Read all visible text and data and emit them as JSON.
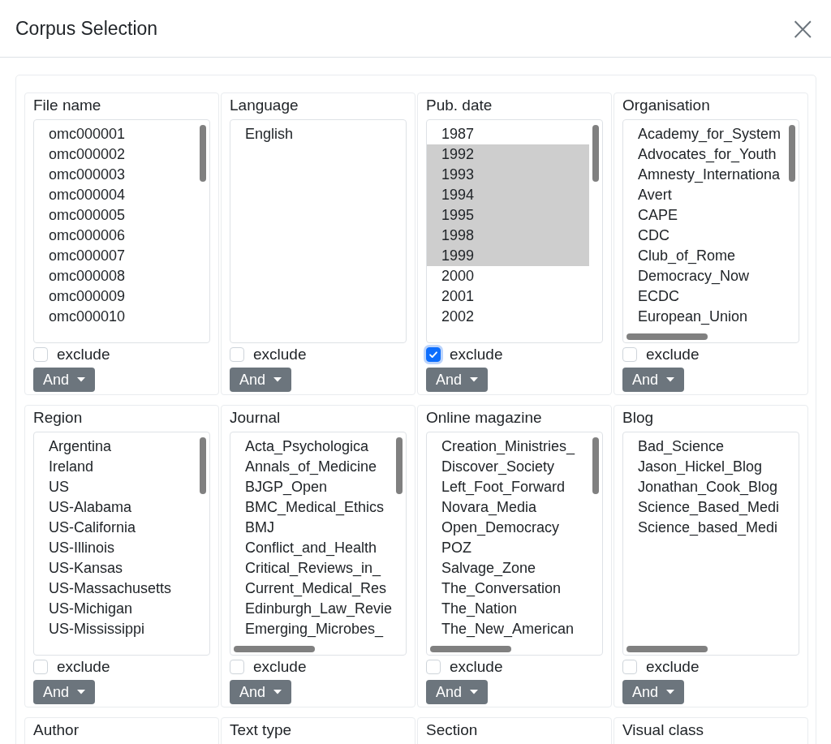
{
  "dialog": {
    "title": "Corpus Selection",
    "close": "×"
  },
  "filters": [
    {
      "label": "File name",
      "scrollbar_vertical": true,
      "scrollbar_horizontal": false,
      "exclude": false,
      "exclude_label": "exclude",
      "operator": "And",
      "options": [
        {
          "text": "omc000001",
          "selected": false
        },
        {
          "text": "omc000002",
          "selected": false
        },
        {
          "text": "omc000003",
          "selected": false
        },
        {
          "text": "omc000004",
          "selected": false
        },
        {
          "text": "omc000005",
          "selected": false
        },
        {
          "text": "omc000006",
          "selected": false
        },
        {
          "text": "omc000007",
          "selected": false
        },
        {
          "text": "omc000008",
          "selected": false
        },
        {
          "text": "omc000009",
          "selected": false
        },
        {
          "text": "omc000010",
          "selected": false
        }
      ]
    },
    {
      "label": "Language",
      "scrollbar_vertical": false,
      "scrollbar_horizontal": false,
      "exclude": false,
      "exclude_label": "exclude",
      "operator": "And",
      "options": [
        {
          "text": "English",
          "selected": false
        }
      ]
    },
    {
      "label": "Pub. date",
      "scrollbar_vertical": true,
      "scrollbar_horizontal": false,
      "exclude": true,
      "exclude_label": "exclude",
      "operator": "And",
      "options": [
        {
          "text": "1987",
          "selected": false
        },
        {
          "text": "1992",
          "selected": true
        },
        {
          "text": "1993",
          "selected": true
        },
        {
          "text": "1994",
          "selected": true
        },
        {
          "text": "1995",
          "selected": true
        },
        {
          "text": "1998",
          "selected": true
        },
        {
          "text": "1999",
          "selected": true
        },
        {
          "text": "2000",
          "selected": false
        },
        {
          "text": "2001",
          "selected": false
        },
        {
          "text": "2002",
          "selected": false
        }
      ]
    },
    {
      "label": "Organisation",
      "scrollbar_vertical": true,
      "scrollbar_horizontal": true,
      "exclude": false,
      "exclude_label": "exclude",
      "operator": "And",
      "options": [
        {
          "text": "Academy_for_System",
          "selected": false
        },
        {
          "text": "Advocates_for_Youth",
          "selected": false
        },
        {
          "text": "Amnesty_Internationa",
          "selected": false
        },
        {
          "text": "Avert",
          "selected": false
        },
        {
          "text": "CAPE",
          "selected": false
        },
        {
          "text": "CDC",
          "selected": false
        },
        {
          "text": "Club_of_Rome",
          "selected": false
        },
        {
          "text": "Democracy_Now",
          "selected": false
        },
        {
          "text": "ECDC",
          "selected": false
        },
        {
          "text": "European_Union",
          "selected": false
        }
      ]
    },
    {
      "label": "Region",
      "scrollbar_vertical": true,
      "scrollbar_horizontal": false,
      "exclude": false,
      "exclude_label": "exclude",
      "operator": "And",
      "options": [
        {
          "text": "Argentina",
          "selected": false
        },
        {
          "text": "Ireland",
          "selected": false
        },
        {
          "text": "US",
          "selected": false
        },
        {
          "text": "US-Alabama",
          "selected": false
        },
        {
          "text": "US-California",
          "selected": false
        },
        {
          "text": "US-Illinois",
          "selected": false
        },
        {
          "text": "US-Kansas",
          "selected": false
        },
        {
          "text": "US-Massachusetts",
          "selected": false
        },
        {
          "text": "US-Michigan",
          "selected": false
        },
        {
          "text": "US-Mississippi",
          "selected": false
        }
      ]
    },
    {
      "label": "Journal",
      "scrollbar_vertical": true,
      "scrollbar_horizontal": true,
      "exclude": false,
      "exclude_label": "exclude",
      "operator": "And",
      "options": [
        {
          "text": "Acta_Psychologica",
          "selected": false
        },
        {
          "text": "Annals_of_Medicine",
          "selected": false
        },
        {
          "text": "BJGP_Open",
          "selected": false
        },
        {
          "text": "BMC_Medical_Ethics",
          "selected": false
        },
        {
          "text": "BMJ",
          "selected": false
        },
        {
          "text": "Conflict_and_Health",
          "selected": false
        },
        {
          "text": "Critical_Reviews_in_",
          "selected": false
        },
        {
          "text": "Current_Medical_Res",
          "selected": false
        },
        {
          "text": "Edinburgh_Law_Revie",
          "selected": false
        },
        {
          "text": "Emerging_Microbes_",
          "selected": false
        }
      ]
    },
    {
      "label": "Online magazine",
      "scrollbar_vertical": true,
      "scrollbar_horizontal": true,
      "exclude": false,
      "exclude_label": "exclude",
      "operator": "And",
      "options": [
        {
          "text": "Creation_Ministries_",
          "selected": false
        },
        {
          "text": "Discover_Society",
          "selected": false
        },
        {
          "text": "Left_Foot_Forward",
          "selected": false
        },
        {
          "text": "Novara_Media",
          "selected": false
        },
        {
          "text": "Open_Democracy",
          "selected": false
        },
        {
          "text": "POZ",
          "selected": false
        },
        {
          "text": "Salvage_Zone",
          "selected": false
        },
        {
          "text": "The_Conversation",
          "selected": false
        },
        {
          "text": "The_Nation",
          "selected": false
        },
        {
          "text": "The_New_American",
          "selected": false
        }
      ]
    },
    {
      "label": "Blog",
      "scrollbar_vertical": false,
      "scrollbar_horizontal": true,
      "exclude": false,
      "exclude_label": "exclude",
      "operator": "And",
      "options": [
        {
          "text": "Bad_Science",
          "selected": false
        },
        {
          "text": "Jason_Hickel_Blog",
          "selected": false
        },
        {
          "text": "Jonathan_Cook_Blog",
          "selected": false
        },
        {
          "text": "Science_Based_Medi",
          "selected": false
        },
        {
          "text": "Science_based_Medi",
          "selected": false
        }
      ]
    },
    {
      "label": "Author"
    },
    {
      "label": "Text type"
    },
    {
      "label": "Section"
    },
    {
      "label": "Visual class"
    }
  ]
}
